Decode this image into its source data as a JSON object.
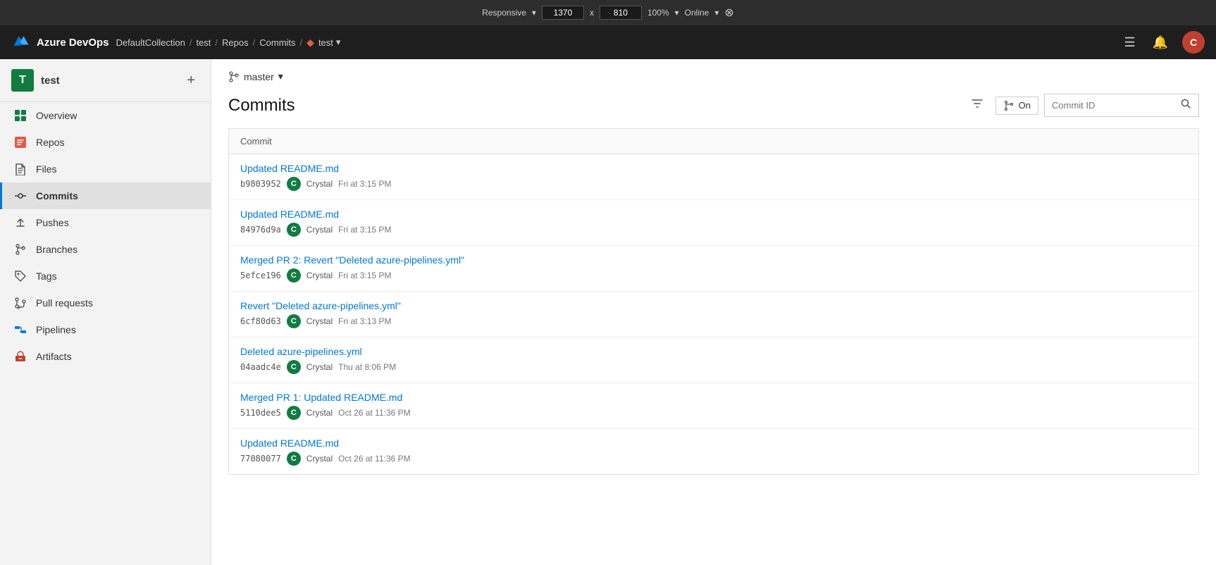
{
  "browser": {
    "mode": "Responsive",
    "width": "1370",
    "x": "x",
    "height": "810",
    "zoom": "100%",
    "status": "Online"
  },
  "header": {
    "app_name": "Azure DevOps",
    "breadcrumb": [
      "DefaultCollection",
      "test",
      "Repos",
      "Commits"
    ],
    "branch_label": "test",
    "user_initial": "C",
    "list_icon": "☰",
    "bell_icon": "🔔"
  },
  "sidebar": {
    "project_initial": "T",
    "project_name": "test",
    "add_label": "+",
    "nav_items": [
      {
        "id": "overview",
        "label": "Overview",
        "icon": "⊞",
        "icon_class": "icon-overview",
        "active": false
      },
      {
        "id": "repos",
        "label": "Repos",
        "icon": "⊞",
        "icon_class": "icon-repos",
        "active": false
      },
      {
        "id": "files",
        "label": "Files",
        "icon": "📄",
        "icon_class": "icon-files",
        "active": false
      },
      {
        "id": "commits",
        "label": "Commits",
        "icon": "◎",
        "icon_class": "icon-commits",
        "active": true
      },
      {
        "id": "pushes",
        "label": "Pushes",
        "icon": "↑",
        "icon_class": "icon-pushes",
        "active": false
      },
      {
        "id": "branches",
        "label": "Branches",
        "icon": "⑂",
        "icon_class": "icon-branches",
        "active": false
      },
      {
        "id": "tags",
        "label": "Tags",
        "icon": "◇",
        "icon_class": "icon-tags",
        "active": false
      },
      {
        "id": "pullrequests",
        "label": "Pull requests",
        "icon": "⑂",
        "icon_class": "icon-pullrequests",
        "active": false
      },
      {
        "id": "pipelines",
        "label": "Pipelines",
        "icon": "▶",
        "icon_class": "icon-pipelines",
        "active": false
      },
      {
        "id": "artifacts",
        "label": "Artifacts",
        "icon": "📦",
        "icon_class": "icon-artifacts",
        "active": false
      }
    ]
  },
  "main": {
    "branch_name": "master",
    "page_title": "Commits",
    "filter_icon": "▽",
    "on_toggle_label": "On",
    "commit_id_placeholder": "Commit ID",
    "table_header": "Commit",
    "commits": [
      {
        "id": "c1",
        "title": "Updated README.md",
        "hash": "b9803952",
        "author": "Crystal",
        "author_initial": "C",
        "date": "Fri at 3:15 PM"
      },
      {
        "id": "c2",
        "title": "Updated README.md",
        "hash": "84976d9a",
        "author": "Crystal",
        "author_initial": "C",
        "date": "Fri at 3:15 PM"
      },
      {
        "id": "c3",
        "title": "Merged PR 2: Revert \"Deleted azure-pipelines.yml\"",
        "hash": "5efce196",
        "author": "Crystal",
        "author_initial": "C",
        "date": "Fri at 3:15 PM"
      },
      {
        "id": "c4",
        "title": "Revert \"Deleted azure-pipelines.yml\"",
        "hash": "6cf80d63",
        "author": "Crystal",
        "author_initial": "C",
        "date": "Fri at 3:13 PM"
      },
      {
        "id": "c5",
        "title": "Deleted azure-pipelines.yml",
        "hash": "04aadc4e",
        "author": "Crystal",
        "author_initial": "C",
        "date": "Thu at 8:06 PM"
      },
      {
        "id": "c6",
        "title": "Merged PR 1: Updated README.md",
        "hash": "5110dee5",
        "author": "Crystal",
        "author_initial": "C",
        "date": "Oct 26 at 11:36 PM"
      },
      {
        "id": "c7",
        "title": "Updated README.md",
        "hash": "77080077",
        "author": "Crystal",
        "author_initial": "C",
        "date": "Oct 26 at 11:36 PM"
      }
    ]
  }
}
